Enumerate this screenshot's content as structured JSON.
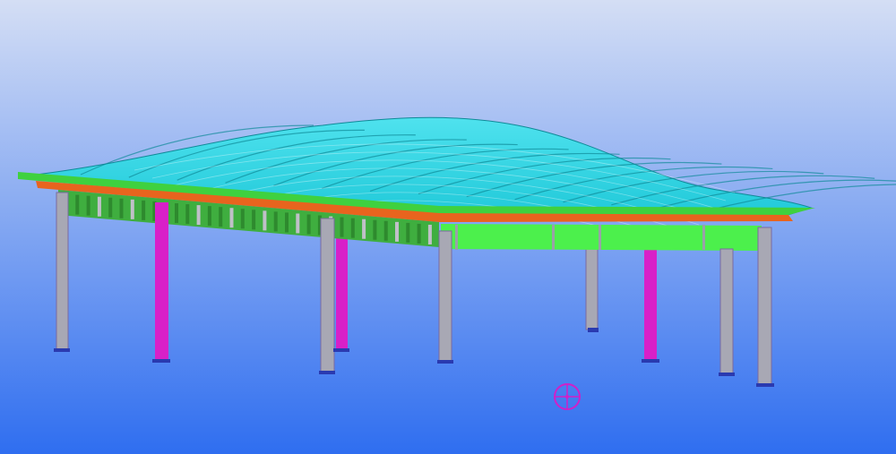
{
  "viewport": {
    "background_top": "#d4def4",
    "background_bottom": "#2f6ef0"
  },
  "colors": {
    "roof_panel": "#1ec8d8",
    "roof_panel_light": "#4fe2ee",
    "roof_rib": "#0f8a98",
    "edge_beam_green": "#3fd13f",
    "edge_beam_orange": "#e8641e",
    "truss_green": "#3fae3f",
    "truss_bright": "#4cf04c",
    "column_gray": "#a8a8b4",
    "column_magenta": "#d820c8",
    "base_plate": "#2a3ab0",
    "pivot_marker": "#d020c8"
  },
  "icons": {
    "rotation_center": "rotation-center-icon"
  }
}
